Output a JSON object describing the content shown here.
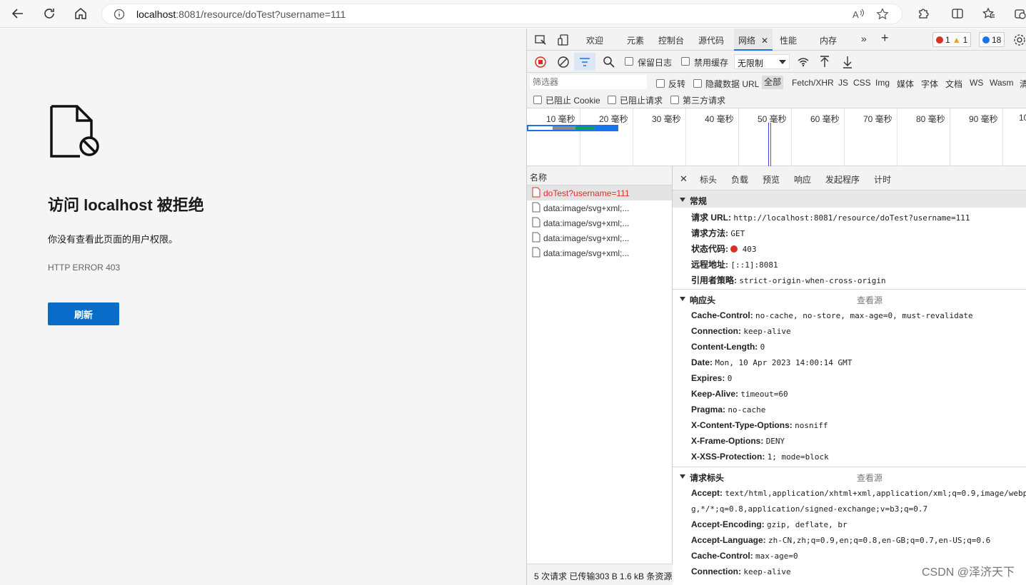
{
  "browser": {
    "url_host": "localhost",
    "url_rest": ":8081/resource/doTest?username=111"
  },
  "error_page": {
    "title": "访问 localhost 被拒绝",
    "message": "你没有查看此页面的用户权限。",
    "code": "HTTP ERROR 403",
    "reload_label": "刷新"
  },
  "devtools": {
    "tabs": [
      "欢迎",
      "元素",
      "控制台",
      "源代码",
      "网络",
      "性能",
      "内存"
    ],
    "badges": {
      "errors": "1",
      "warnings": "1",
      "messages": "18"
    },
    "net_toolbar": {
      "preserve_log": "保留日志",
      "disable_cache": "禁用缓存",
      "throttle": "无限制"
    },
    "filter": {
      "placeholder": "筛选器",
      "invert": "反转",
      "hide_data_urls": "隐藏数据 URL",
      "types": [
        "全部",
        "Fetch/XHR",
        "JS",
        "CSS",
        "Img",
        "媒体",
        "字体",
        "文档",
        "WS",
        "Wasm",
        "清"
      ],
      "blocked_cookies": "已阻止 Cookie",
      "blocked_requests": "已阻止请求",
      "third_party": "第三方请求"
    },
    "overview_ticks": [
      "10 毫秒",
      "20 毫秒",
      "30 毫秒",
      "40 毫秒",
      "50 毫秒",
      "60 毫秒",
      "70 毫秒",
      "80 毫秒",
      "90 毫秒",
      "10"
    ],
    "request_list": {
      "header": "名称",
      "rows": [
        "doTest?username=111",
        "data:image/svg+xml;...",
        "data:image/svg+xml;...",
        "data:image/svg+xml;...",
        "data:image/svg+xml;..."
      ],
      "status": "5 次请求  已传输303 B  1.6 kB 条资源"
    },
    "detail_tabs": [
      "标头",
      "负载",
      "预览",
      "响应",
      "发起程序",
      "计时"
    ],
    "general": {
      "title": "常规",
      "rows": [
        {
          "k": "请求 URL:",
          "v": "http://localhost:8081/resource/doTest?username=111"
        },
        {
          "k": "请求方法:",
          "v": "GET"
        },
        {
          "k": "状态代码:",
          "v": "403"
        },
        {
          "k": "远程地址:",
          "v": "[::1]:8081"
        },
        {
          "k": "引用者策略:",
          "v": "strict-origin-when-cross-origin"
        }
      ]
    },
    "response_headers": {
      "title": "响应头",
      "view_source": "查看源",
      "rows": [
        {
          "k": "Cache-Control:",
          "v": "no-cache, no-store, max-age=0, must-revalidate"
        },
        {
          "k": "Connection:",
          "v": "keep-alive"
        },
        {
          "k": "Content-Length:",
          "v": "0"
        },
        {
          "k": "Date:",
          "v": "Mon, 10 Apr 2023 14:00:14 GMT"
        },
        {
          "k": "Expires:",
          "v": "0"
        },
        {
          "k": "Keep-Alive:",
          "v": "timeout=60"
        },
        {
          "k": "Pragma:",
          "v": "no-cache"
        },
        {
          "k": "X-Content-Type-Options:",
          "v": "nosniff"
        },
        {
          "k": "X-Frame-Options:",
          "v": "DENY"
        },
        {
          "k": "X-XSS-Protection:",
          "v": "1; mode=block"
        }
      ]
    },
    "request_headers": {
      "title": "请求标头",
      "view_source": "查看源",
      "accept_key": "Accept:",
      "accept_v1": "text/html,application/xhtml+xml,application/xml;q=0.9,image/webp",
      "accept_v2": "g,*/*;q=0.8,application/signed-exchange;v=b3;q=0.7",
      "rows": [
        {
          "k": "Accept-Encoding:",
          "v": "gzip, deflate, br"
        },
        {
          "k": "Accept-Language:",
          "v": "zh-CN,zh;q=0.9,en;q=0.8,en-GB;q=0.7,en-US;q=0.6"
        },
        {
          "k": "Cache-Control:",
          "v": "max-age=0"
        },
        {
          "k": "Connection:",
          "v": "keep-alive"
        }
      ]
    }
  },
  "watermark": "CSDN @泽济天下"
}
